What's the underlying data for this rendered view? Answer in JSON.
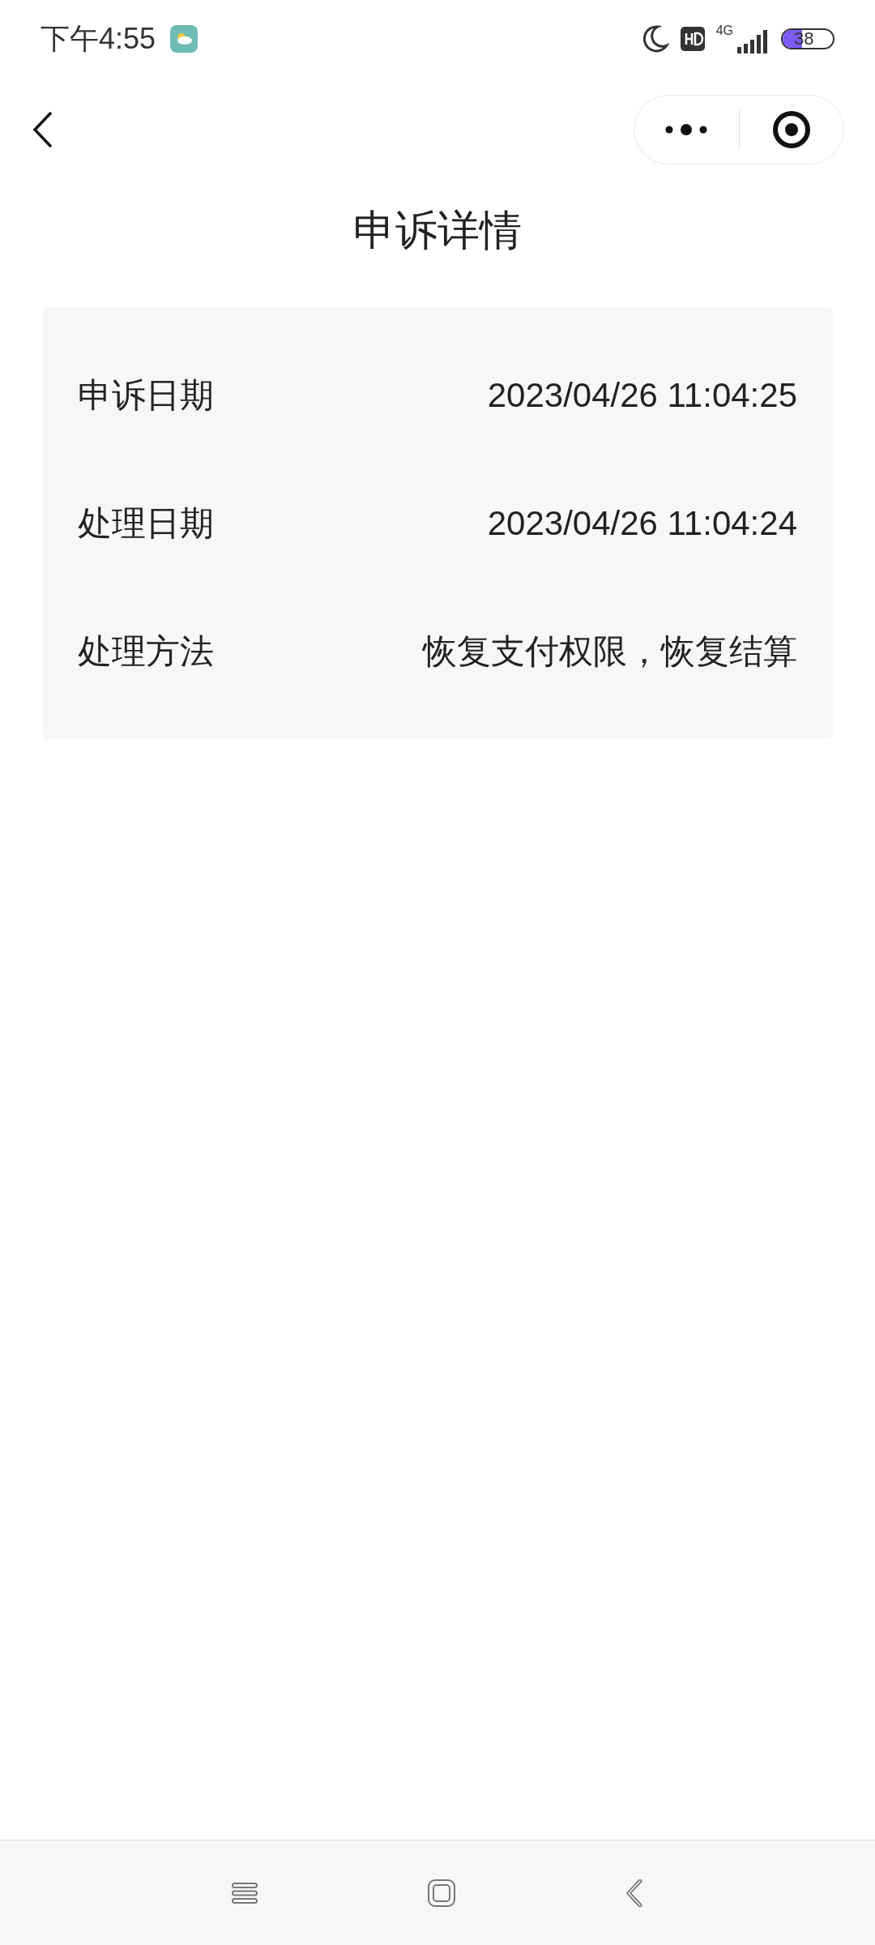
{
  "status_bar": {
    "time": "下午4:55",
    "network": "4G",
    "battery": {
      "text": "38",
      "level": 0.38
    }
  },
  "title": "申诉详情",
  "details": [
    {
      "label": "申诉日期",
      "value": "2023/04/26 11:04:25"
    },
    {
      "label": "处理日期",
      "value": "2023/04/26 11:04:24"
    },
    {
      "label": "处理方法",
      "value": "恢复支付权限，恢复结算"
    }
  ]
}
